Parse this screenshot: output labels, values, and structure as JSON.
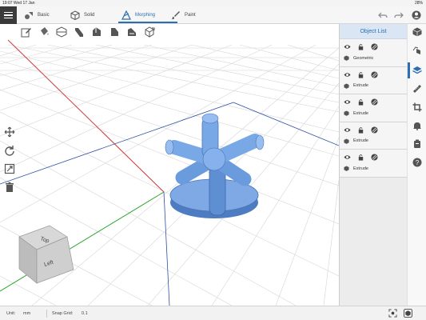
{
  "status": {
    "time_date": "19:07  Wed 17 Jan",
    "battery": "28%"
  },
  "tabs": [
    {
      "label": "Basic",
      "icon": "basic-shapes-icon"
    },
    {
      "label": "Solid",
      "icon": "cube-icon"
    },
    {
      "label": "Morphing",
      "icon": "morphing-icon",
      "active": true
    },
    {
      "label": "Paint",
      "icon": "brush-icon"
    }
  ],
  "panel": {
    "title": "Object List",
    "objects": [
      {
        "label": "Geometric"
      },
      {
        "label": "Extrude"
      },
      {
        "label": "Extrude"
      },
      {
        "label": "Extrude"
      },
      {
        "label": "Extrude"
      }
    ]
  },
  "viewcube": {
    "top_face": "Top",
    "front_face": "Left"
  },
  "bottom": {
    "unit_label": "Unit:",
    "unit_value": "mm",
    "snap_label": "Snap Grid:",
    "snap_value": "0.1"
  },
  "colors": {
    "accent": "#2c6db4",
    "model": "#6b9bd8",
    "axis_x": "#d33a3a",
    "axis_y": "#2aa52a",
    "axis_z": "#2d4fa6"
  }
}
